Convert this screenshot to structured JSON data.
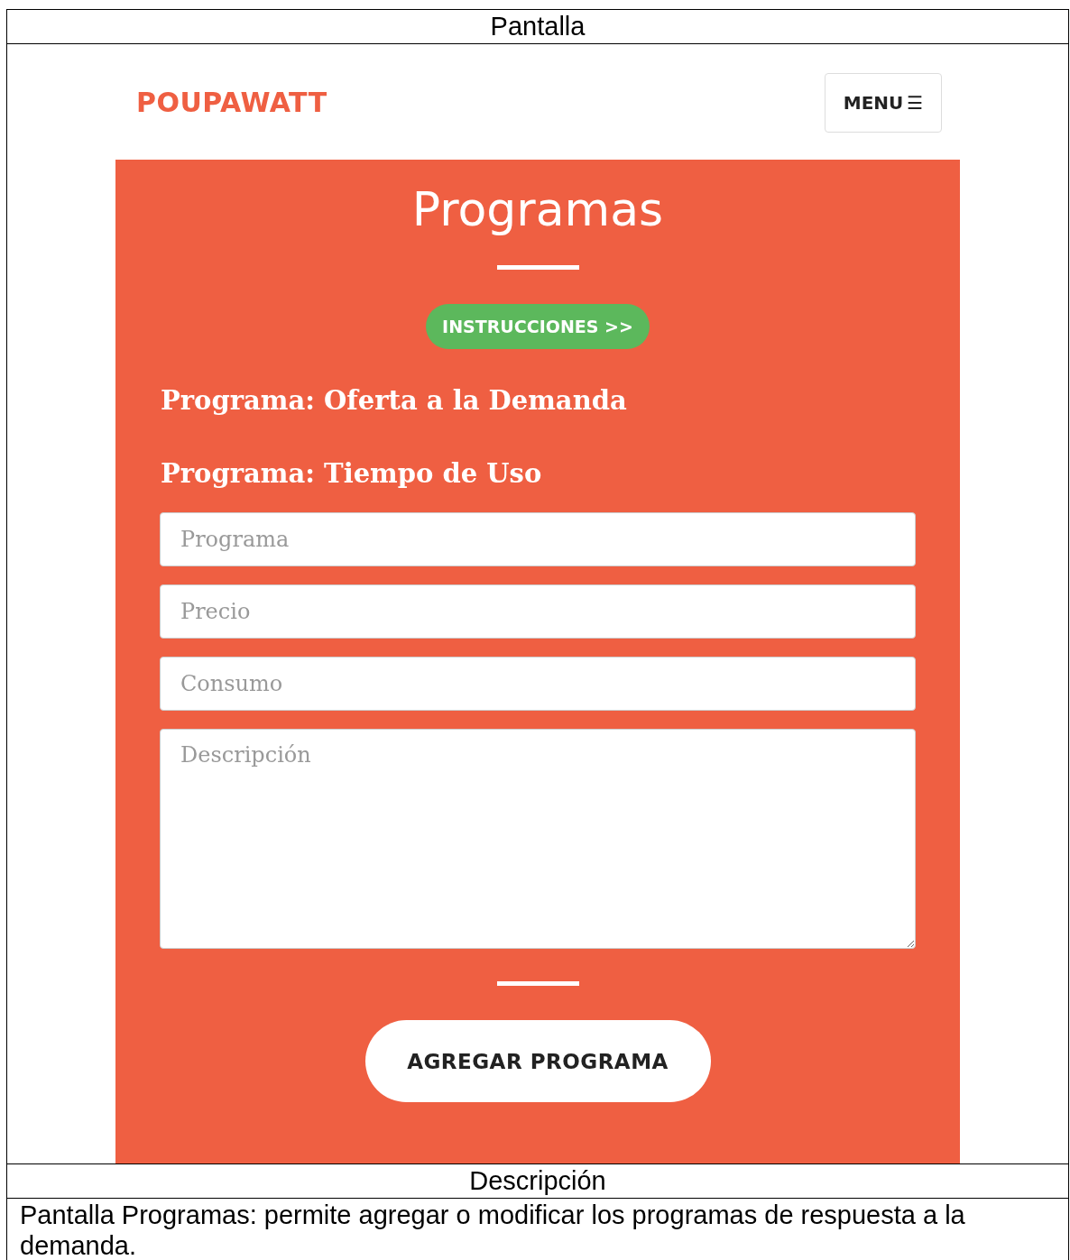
{
  "table": {
    "screen_heading": "Pantalla",
    "description_heading": "Descripción",
    "description": "Pantalla Programas: permite agregar o modificar los programas de respuesta a la demanda."
  },
  "screen": {
    "logo": "POUPAWATT",
    "menu_button": {
      "label": "MENU",
      "icon": "☰"
    },
    "title": "Programas",
    "instructions_button": "INSTRUCCIONES >>",
    "programs": [
      "Programa: Oferta a la Demanda",
      "Programa: Tiempo de Uso"
    ],
    "fields": [
      {
        "kind": "input",
        "placeholder": "Programa"
      },
      {
        "kind": "input",
        "placeholder": "Precio"
      },
      {
        "kind": "input",
        "placeholder": "Consumo"
      },
      {
        "kind": "textarea",
        "placeholder": "Descripción"
      }
    ],
    "submit_button": "AGREGAR PROGRAMA"
  }
}
